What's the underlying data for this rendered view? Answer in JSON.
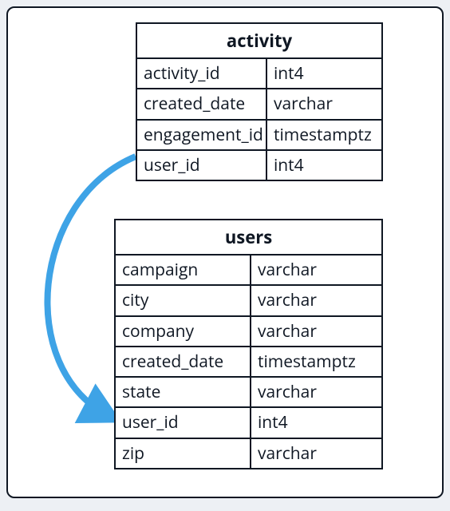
{
  "tables": [
    {
      "name": "activity",
      "columns": [
        {
          "name": "activity_id",
          "type": "int4"
        },
        {
          "name": "created_date",
          "type": "varchar"
        },
        {
          "name": "engagement_id",
          "type": "timestamptz"
        },
        {
          "name": "user_id",
          "type": "int4"
        }
      ]
    },
    {
      "name": "users",
      "columns": [
        {
          "name": "campaign",
          "type": "varchar"
        },
        {
          "name": "city",
          "type": "varchar"
        },
        {
          "name": "company",
          "type": "varchar"
        },
        {
          "name": "created_date",
          "type": "timestamptz"
        },
        {
          "name": "state",
          "type": "varchar"
        },
        {
          "name": "user_id",
          "type": "int4"
        },
        {
          "name": "zip",
          "type": "varchar"
        }
      ]
    }
  ],
  "relationship": {
    "from_table": "activity",
    "from_column": "user_id",
    "to_table": "users",
    "to_column": "user_id",
    "arrow_color": "#3ea3e6"
  }
}
